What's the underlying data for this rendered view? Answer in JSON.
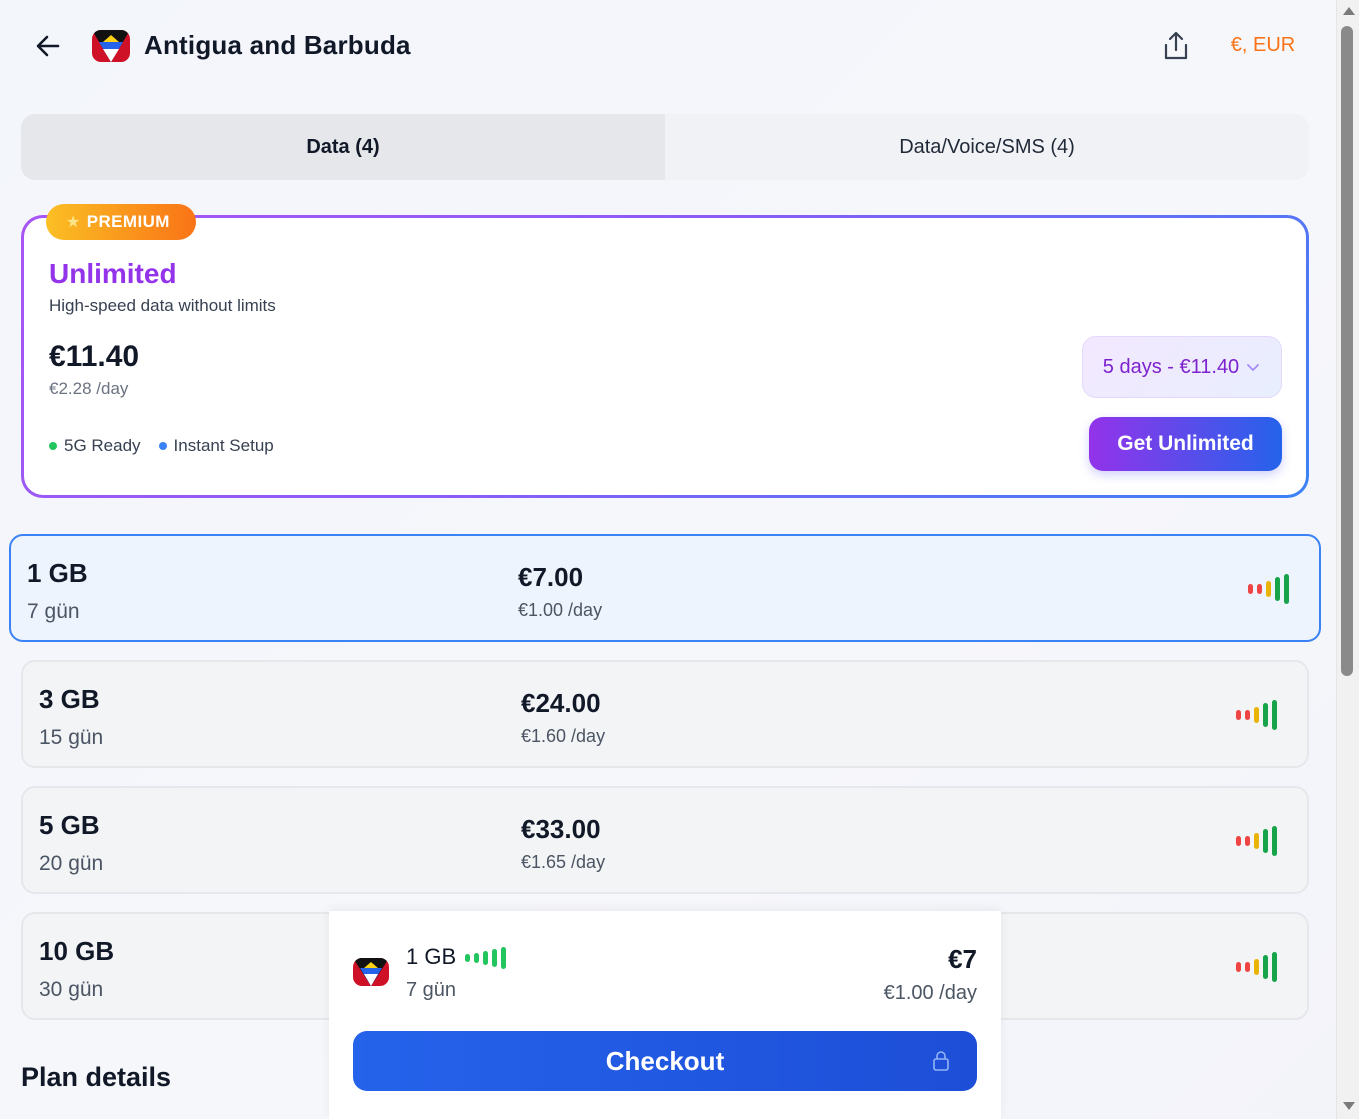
{
  "header": {
    "title": "Antigua and Barbuda",
    "currency": "€, EUR"
  },
  "tabs": [
    {
      "label": "Data (4)",
      "active": true
    },
    {
      "label": "Data/Voice/SMS (4)",
      "active": false
    }
  ],
  "premium": {
    "badge": "PREMIUM",
    "title": "Unlimited",
    "subtitle": "High-speed data without limits",
    "price": "€11.40",
    "per_day": "€2.28 /day",
    "features": [
      {
        "label": "5G Ready",
        "color": "#22c55e"
      },
      {
        "label": "Instant Setup",
        "color": "#3b82f6"
      }
    ],
    "duration_selected": "5 days - €11.40",
    "cta": "Get Unlimited"
  },
  "plans": [
    {
      "data": "1 GB",
      "days": "7 gün",
      "price": "€7.00",
      "per_day": "€1.00 /day",
      "selected": true
    },
    {
      "data": "3 GB",
      "days": "15 gün",
      "price": "€24.00",
      "per_day": "€1.60 /day",
      "selected": false
    },
    {
      "data": "5 GB",
      "days": "20 gün",
      "price": "€33.00",
      "per_day": "€1.65 /day",
      "selected": false
    },
    {
      "data": "10 GB",
      "days": "30 gün",
      "price": "",
      "per_day": "",
      "selected": false
    }
  ],
  "plan_details_heading": "Plan details",
  "checkout": {
    "data": "1 GB",
    "days": "7 gün",
    "price": "€7",
    "per_day": "€1.00 /day",
    "button": "Checkout"
  },
  "colors": {
    "accent": "#2563eb",
    "premium_purple": "#9333ea",
    "currency_orange": "#f97316",
    "signal_red": "#ef4444",
    "signal_yellow": "#eab308",
    "signal_green": "#16a34a"
  },
  "icons": [
    "back-arrow-icon",
    "flag-icon",
    "share-icon",
    "star-icon",
    "chevron-down-icon",
    "signal-strength-icon",
    "lock-icon"
  ]
}
